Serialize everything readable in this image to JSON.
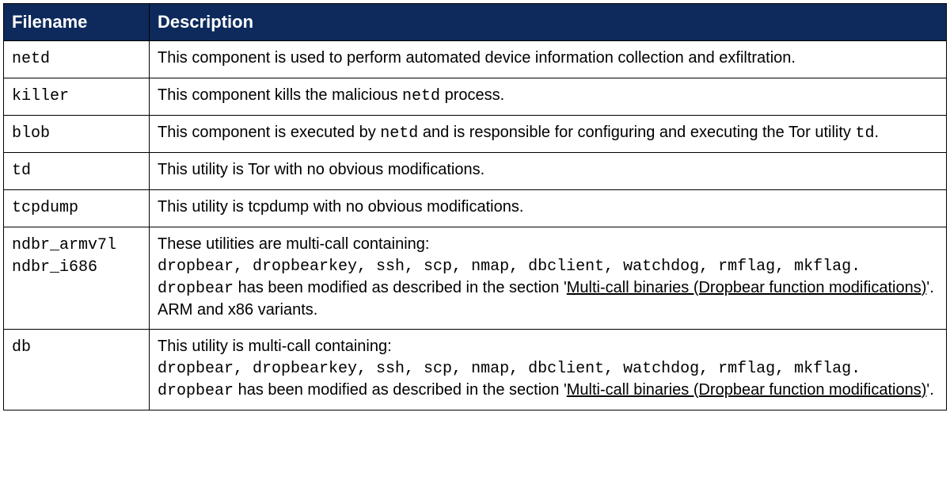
{
  "headers": {
    "filename": "Filename",
    "description": "Description"
  },
  "rows": [
    {
      "filename_parts": [
        {
          "text": "netd",
          "mono": true
        }
      ],
      "description_parts": [
        {
          "text": "This component is used to perform automated device information collection and exfiltration."
        }
      ]
    },
    {
      "filename_parts": [
        {
          "text": "killer",
          "mono": true
        }
      ],
      "description_parts": [
        {
          "text": "This component kills the malicious "
        },
        {
          "text": "netd",
          "mono": true
        },
        {
          "text": " process."
        }
      ]
    },
    {
      "filename_parts": [
        {
          "text": "blob",
          "mono": true
        }
      ],
      "description_parts": [
        {
          "text": "This component is executed by "
        },
        {
          "text": "netd",
          "mono": true
        },
        {
          "text": " and is responsible for configuring and executing the Tor utility "
        },
        {
          "text": "td",
          "mono": true
        },
        {
          "text": "."
        }
      ]
    },
    {
      "filename_parts": [
        {
          "text": "td",
          "mono": true
        }
      ],
      "description_parts": [
        {
          "text": "This utility is Tor with no obvious modifications."
        }
      ]
    },
    {
      "filename_parts": [
        {
          "text": "tcpdump",
          "mono": true
        }
      ],
      "description_parts": [
        {
          "text": "This utility is tcpdump with no obvious modifications."
        }
      ]
    },
    {
      "filename_parts": [
        {
          "text": "ndbr_armv7l",
          "mono": true
        },
        {
          "br": true
        },
        {
          "text": "ndbr_i686",
          "mono": true
        }
      ],
      "description_parts": [
        {
          "text": "These utilities are multi-call containing:"
        },
        {
          "br": true
        },
        {
          "text": "dropbear, dropbearkey, ssh, scp, nmap, dbclient, watchdog, rmflag, mkflag. dropbear",
          "mono": true
        },
        {
          "text": " has been modified as described in the section '"
        },
        {
          "text": "Multi-call binaries (Dropbear function modifications)",
          "link": true
        },
        {
          "text": "'. ARM and x86 variants."
        }
      ]
    },
    {
      "filename_parts": [
        {
          "text": "db",
          "mono": true
        }
      ],
      "description_parts": [
        {
          "text": "This utility is multi-call containing:"
        },
        {
          "br": true
        },
        {
          "text": "dropbear, dropbearkey, ssh, scp, nmap, dbclient, watchdog, rmflag, mkflag. dropbear",
          "mono": true
        },
        {
          "text": " has been modified as described in the section '"
        },
        {
          "text": "Multi-call binaries (Dropbear function modifications)",
          "link": true
        },
        {
          "text": "'."
        }
      ]
    }
  ]
}
